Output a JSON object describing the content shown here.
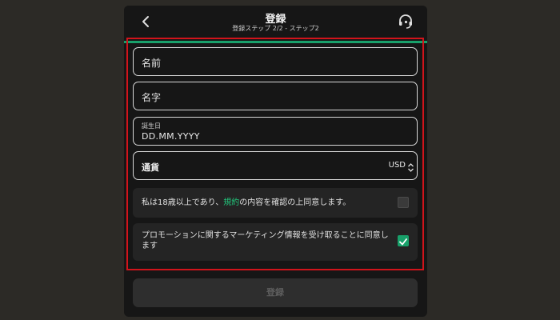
{
  "header": {
    "title": "登録",
    "subtitle": "登録ステップ 2/2 - ステップ2",
    "back_icon": "chevron-left-icon",
    "support_icon": "headset-icon"
  },
  "colors": {
    "accent": "#18a06a",
    "link": "#22c47a",
    "highlight_border": "#d1141b"
  },
  "progress": {
    "fraction": 1.0
  },
  "form": {
    "first_name": {
      "placeholder": "名前"
    },
    "last_name": {
      "placeholder": "名字"
    },
    "birthdate": {
      "label": "誕生日",
      "placeholder": "DD.MM.YYYY"
    },
    "currency": {
      "label": "通貨",
      "value": "USD"
    }
  },
  "consents": {
    "terms": {
      "text_before": "私は18歳以上であり、",
      "link_text": "規約",
      "text_after": "の内容を確認の上同意します。",
      "checked": false
    },
    "marketing": {
      "text": "プロモーションに関するマーケティング情報を受け取ることに同意します",
      "checked": true
    }
  },
  "submit": {
    "label": "登録",
    "enabled": false
  }
}
